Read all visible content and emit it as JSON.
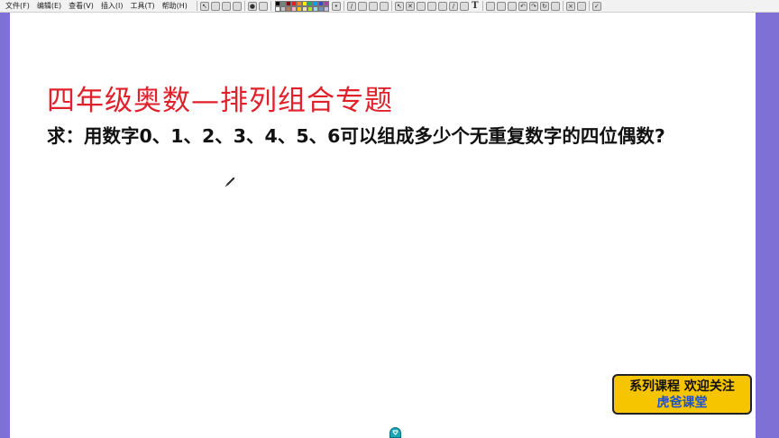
{
  "menu": [
    {
      "label": "文件(F)"
    },
    {
      "label": "编辑(E)"
    },
    {
      "label": "查看(V)"
    },
    {
      "label": "插入(I)"
    },
    {
      "label": "工具(T)"
    },
    {
      "label": "帮助(H)"
    }
  ],
  "toolbar": {
    "palette": [
      "#000000",
      "#7f7f7f",
      "#880015",
      "#ed1c24",
      "#ff7f27",
      "#fff200",
      "#22b14c",
      "#00a2e8",
      "#3f48cc",
      "#a349a4",
      "#ffffff",
      "#c3c3c3",
      "#b97a57",
      "#ffaec9",
      "#ffc90e",
      "#efe4b0",
      "#b5e61d",
      "#99d9ea",
      "#7092be",
      "#c8bfe7"
    ],
    "text_tool_label": "T"
  },
  "content": {
    "title": "四年级奥数—排列组合专题",
    "question": "求：用数字0、1、2、3、4、5、6可以组成多少个无重复数字的四位偶数?"
  },
  "badge": {
    "line1": "系列课程 欢迎关注",
    "line2": "虎爸课堂"
  },
  "colors": {
    "side_bar": "#7e70d4",
    "title": "#e0202a",
    "badge_bg": "#f7c500",
    "badge_brand": "#1b4fd8"
  }
}
